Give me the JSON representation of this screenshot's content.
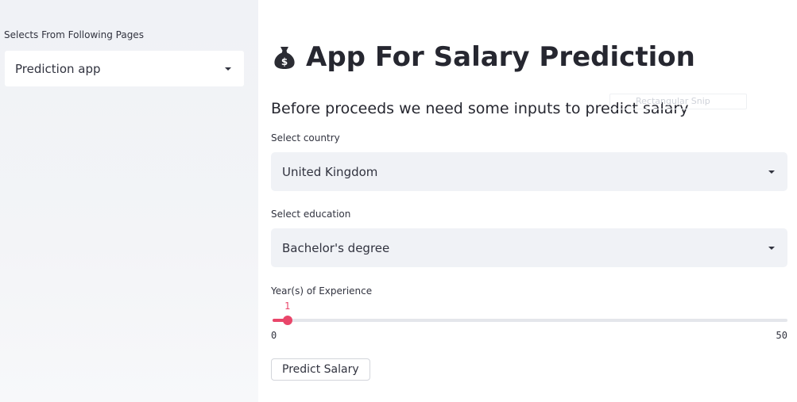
{
  "sidebar": {
    "label": "Selects From Following Pages",
    "page_select": {
      "value": "Prediction app"
    }
  },
  "main": {
    "title": "App For Salary Prediction",
    "title_icon": "money-bag-icon",
    "subtitle": "Before proceeds we need some inputs to predict salary",
    "overlay_text": "Rectangular Snip",
    "country": {
      "label": "Select country",
      "value": "United Kingdom"
    },
    "education": {
      "label": "Select education",
      "value": "Bachelor's degree"
    },
    "experience": {
      "label": "Year(s) of Experience",
      "value": 1,
      "value_text": "1",
      "min": 0,
      "max": 50,
      "min_text": "0",
      "max_text": "50"
    },
    "predict_button": "Predict Salary"
  },
  "colors": {
    "sidebar_bg": "#f0f2f6",
    "select_bg": "#f0f2f6",
    "accent": "#e9466a",
    "text": "#262730"
  }
}
